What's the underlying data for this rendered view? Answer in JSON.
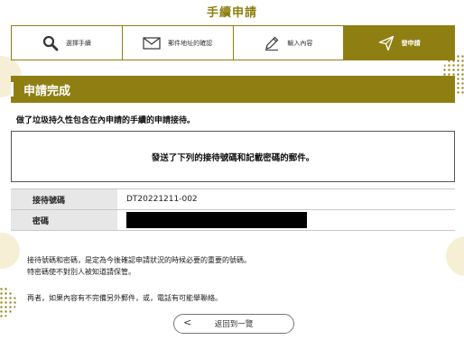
{
  "header": {
    "title": "手續申請"
  },
  "steps": [
    {
      "label": "選擇手續",
      "icon": "search-icon"
    },
    {
      "label": "郵件地址的確認",
      "icon": "envelope-icon"
    },
    {
      "label": "輸入內容",
      "icon": "pencil-icon"
    },
    {
      "label": "發申請",
      "icon": "send-icon",
      "active": true
    }
  ],
  "section": {
    "title": "申請完成"
  },
  "intro_text": "做了垃圾持久性包含在內申請的手續的申請接待。",
  "notice": "發送了下列的接待號碼和記載密碼的郵件。",
  "info": {
    "reception_label": "接待號碼",
    "reception_value": "DT20221211-002",
    "password_label": "密碼"
  },
  "notes": {
    "line1": "接待號碼和密碼，是定為今後確認申請狀況的時候必要的重要的號碼。",
    "line2": "特密碼使不對別人被知道請保管。",
    "line3": "再者，如果內容有不完備另外郵件，或，電話有可能舉聯絡。"
  },
  "back_button": {
    "label": "返回到一覽"
  },
  "colors": {
    "accent": "#8f7f12",
    "label_bg": "#e7e7e7"
  }
}
